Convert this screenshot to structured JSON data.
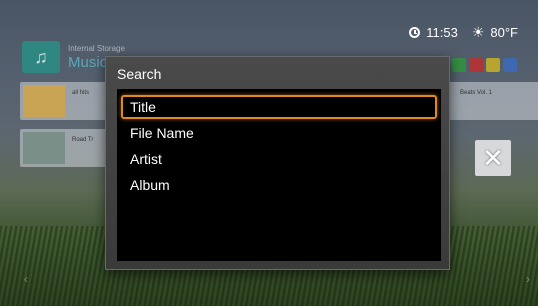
{
  "status": {
    "time": "11:53",
    "temperature": "80°F",
    "clock_icon": "clock-icon",
    "weather_icon": "sun-icon"
  },
  "background": {
    "storage_label": "Internal Storage",
    "section_title": "Music",
    "row1_text": "all hits",
    "row1_text_right": "Beats Vol. 1",
    "row2_text": "Road Tr"
  },
  "dialog": {
    "title": "Search",
    "options": [
      {
        "label": "Title",
        "selected": true
      },
      {
        "label": "File Name",
        "selected": false
      },
      {
        "label": "Artist",
        "selected": false
      },
      {
        "label": "Album",
        "selected": false
      }
    ]
  },
  "colors": {
    "focus": "#e08a1e",
    "accent": "#5cc6d6"
  }
}
